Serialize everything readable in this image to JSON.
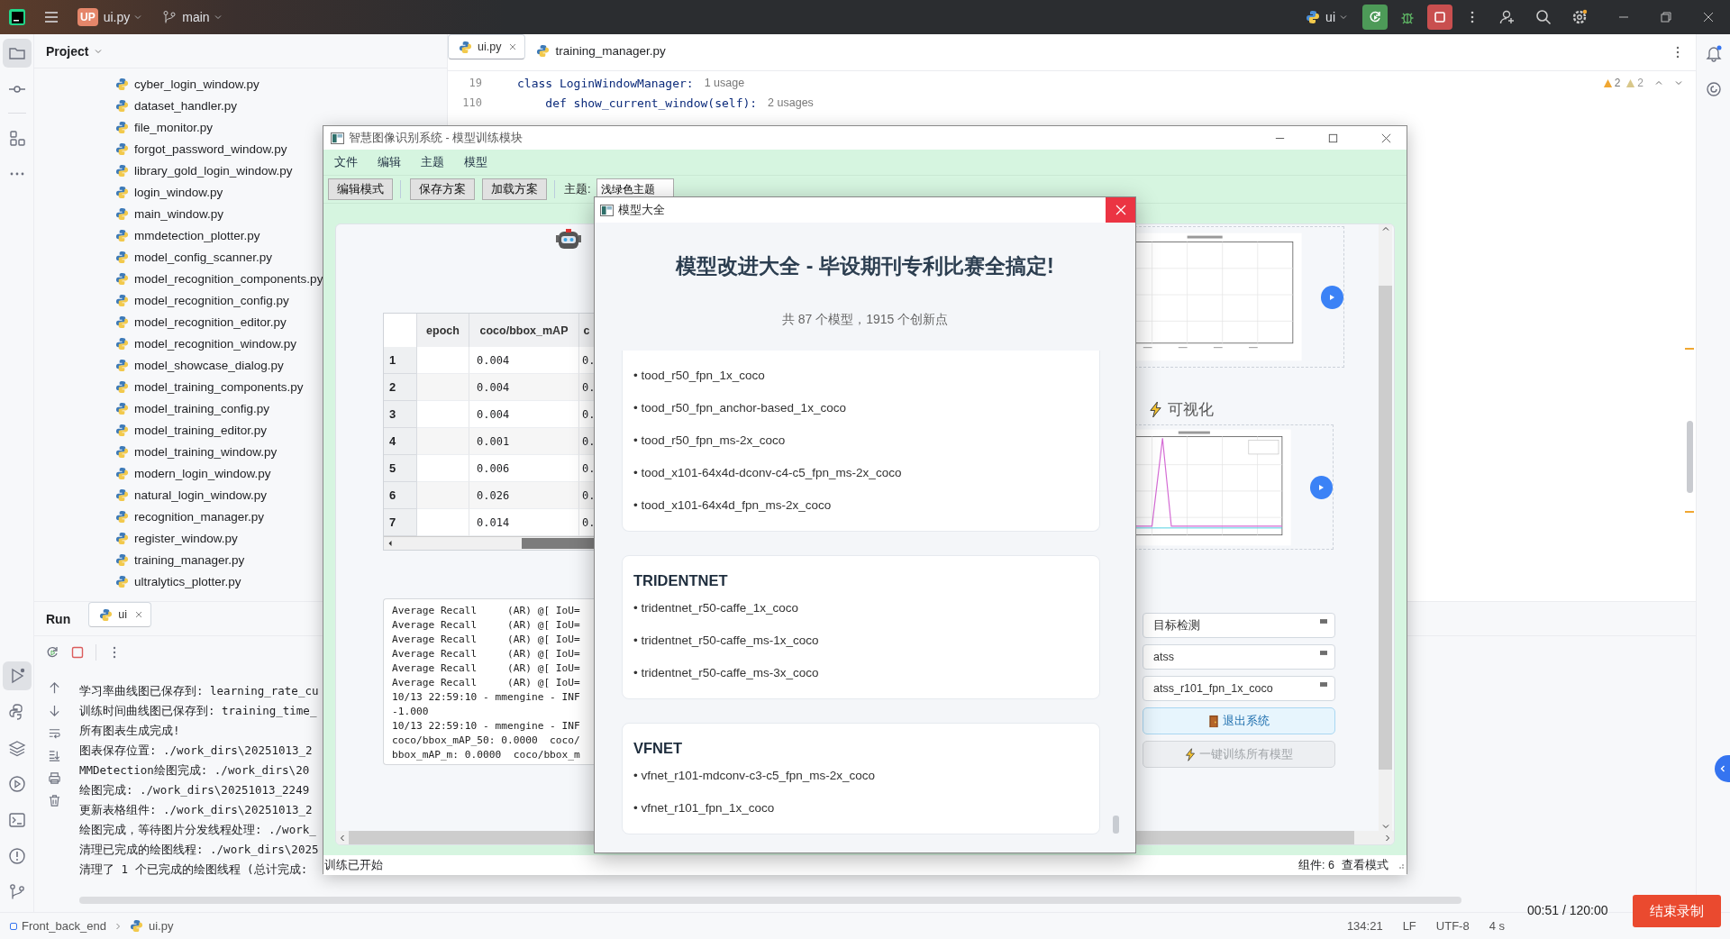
{
  "ide": {
    "title_bar": {
      "project_badge": "UP",
      "project": "ui.py",
      "branch": "main",
      "run_config": "ui"
    },
    "project_panel": {
      "title": "Project",
      "files": [
        "cyber_login_window.py",
        "dataset_handler.py",
        "file_monitor.py",
        "forgot_password_window.py",
        "library_gold_login_window.py",
        "login_window.py",
        "main_window.py",
        "mmdetection_plotter.py",
        "model_config_scanner.py",
        "model_recognition_components.py",
        "model_recognition_config.py",
        "model_recognition_editor.py",
        "model_recognition_window.py",
        "model_showcase_dialog.py",
        "model_training_components.py",
        "model_training_config.py",
        "model_training_editor.py",
        "model_training_window.py",
        "modern_login_window.py",
        "natural_login_window.py",
        "recognition_manager.py",
        "register_window.py",
        "training_manager.py",
        "ultralytics_plotter.py"
      ]
    },
    "editor": {
      "tabs": [
        {
          "label": "ui.py",
          "selected": true
        },
        {
          "label": "training_manager.py",
          "selected": false
        }
      ],
      "lines": [
        {
          "number": "19",
          "code": "class LoginWindowManager:",
          "hint": "1 usage"
        },
        {
          "number": "110",
          "code": "    def show_current_window(self):",
          "hint": "2 usages"
        }
      ],
      "inspections": [
        {
          "kind": "warning",
          "count": "2"
        },
        {
          "kind": "weak_warning",
          "count": "2"
        }
      ]
    },
    "run_panel": {
      "title": "Run",
      "tabs": [
        {
          "label": "ui",
          "selected": true
        }
      ],
      "console": [
        "学习率曲线图已保存到: learning_rate_cu",
        "训练时间曲线图已保存到: training_time_",
        "所有图表生成完成!",
        "图表保存位置: ./work_dirs\\20251013_2",
        "MMDetection绘图完成: ./work_dirs\\20",
        "绘图完成: ./work_dirs\\20251013_2249",
        "更新表格组件: ./work_dirs\\20251013_2",
        "绘图完成，等待图片分发线程处理: ./work_",
        "清理已完成的绘图线程: ./work_dirs\\2025",
        "清理了 1 个已完成的绘图线程 (总计完成: "
      ]
    },
    "status_bar": {
      "breadcrumbs": [
        {
          "label": "Front_back_end",
          "kind": "module"
        },
        {
          "label": "ui.py",
          "kind": "python"
        }
      ],
      "items": [
        "134:21",
        "LF",
        "UTF-8",
        "4 s"
      ]
    }
  },
  "training_window": {
    "title": "智慧图像识别系统 - 模型训练模块",
    "menu": [
      "文件",
      "编辑",
      "主题",
      "模型"
    ],
    "toolbar": {
      "buttons": [
        "编辑模式",
        "保存方案",
        "加载方案"
      ],
      "theme_label": "主题:",
      "theme_value": "浅绿色主题"
    },
    "results_table": {
      "columns": [
        "epoch",
        "coco/bbox_mAP",
        "c"
      ],
      "rows": [
        {
          "label": "1",
          "coco_bbox_map": "0.004",
          "column_3": "0."
        },
        {
          "label": "2",
          "coco_bbox_map": "0.004",
          "column_3": "0."
        },
        {
          "label": "3",
          "coco_bbox_map": "0.004",
          "column_3": "0."
        },
        {
          "label": "4",
          "coco_bbox_map": "0.001",
          "column_3": "0."
        },
        {
          "label": "5",
          "coco_bbox_map": "0.006",
          "column_3": "0."
        },
        {
          "label": "6",
          "coco_bbox_map": "0.026",
          "column_3": "0."
        },
        {
          "label": "7",
          "coco_bbox_map": "0.014",
          "column_3": "0."
        }
      ]
    },
    "log": [
      "Average Recall     (AR) @[ IoU=",
      "Average Recall     (AR) @[ IoU=",
      "Average Recall     (AR) @[ IoU=",
      "Average Recall     (AR) @[ IoU=",
      "Average Recall     (AR) @[ IoU=",
      "Average Recall     (AR) @[ IoU=",
      "10/13 22:59:10 - mmengine - INF",
      "-1.000",
      "10/13 22:59:10 - mmengine - INF",
      "coco/bbox_mAP_50: 0.0000  coco/",
      "bbox_mAP_m: 0.0000  coco/bbox_m"
    ],
    "visualization_title": "可视化",
    "selects": [
      "目标检测",
      "atss",
      "atss_r101_fpn_1x_coco"
    ],
    "buttons": [
      {
        "label": "退出系统",
        "kind": "exit",
        "disabled": false
      },
      {
        "label": "一键训练所有模型",
        "kind": "train",
        "disabled": true
      }
    ],
    "status": {
      "message": "训练已开始",
      "components": "组件: 6",
      "mode": "查看模式"
    }
  },
  "model_dialog": {
    "title": "模型大全",
    "heading": "模型改进大全 - 毕设期刊专利比赛全搞定!",
    "summary": "共 87 个模型，1915 个创新点",
    "groups": [
      {
        "models": [
          "• tood_r50_fpn_1x_coco",
          "• tood_r50_fpn_anchor-based_1x_coco",
          "• tood_r50_fpn_ms-2x_coco",
          "• tood_x101-64x4d-dconv-c4-c5_fpn_ms-2x_coco",
          "• tood_x101-64x4d_fpn_ms-2x_coco"
        ]
      },
      {
        "name": "TRIDENTNET",
        "models": [
          "• tridentnet_r50-caffe_1x_coco",
          "• tridentnet_r50-caffe_ms-1x_coco",
          "• tridentnet_r50-caffe_ms-3x_coco"
        ]
      },
      {
        "name": "VFNET",
        "models": [
          "• vfnet_r101-mdconv-c3-c5_fpn_ms-2x_coco",
          "• vfnet_r101_fpn_1x_coco"
        ]
      }
    ]
  },
  "recorder": {
    "time": "00:51 / 120:00",
    "stop_button": "结束录制"
  }
}
